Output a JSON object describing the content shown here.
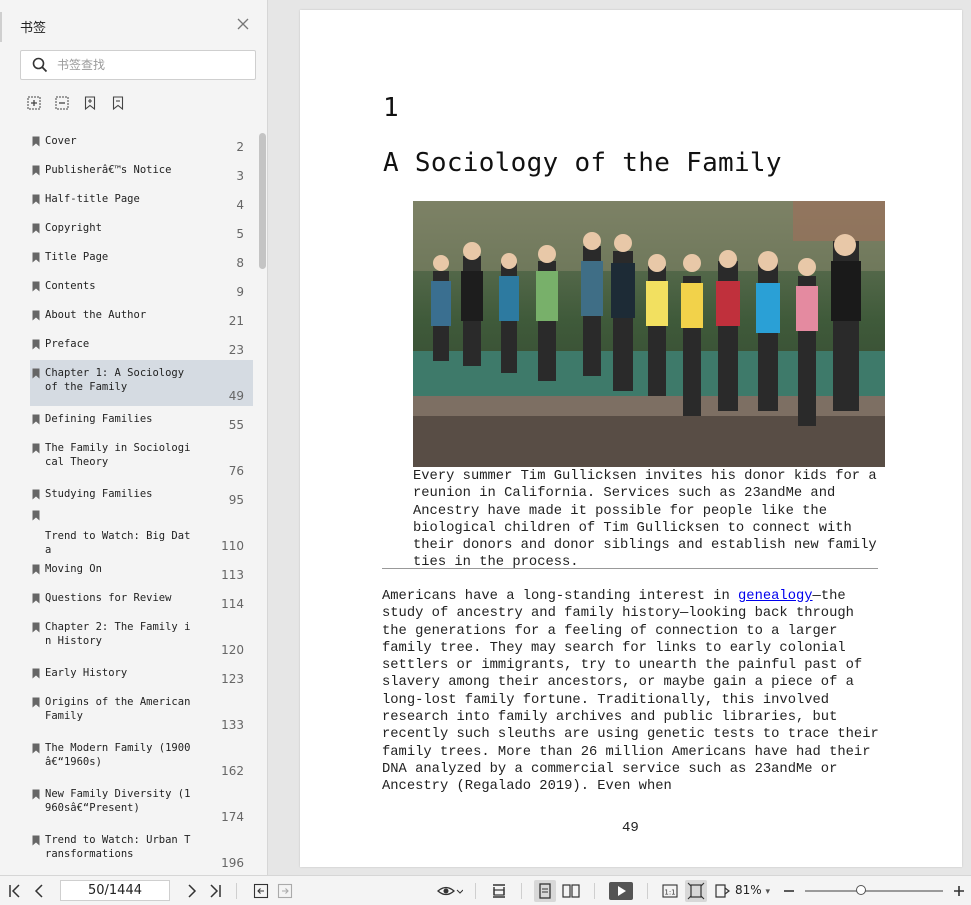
{
  "sidebar": {
    "title": "书签",
    "search_placeholder": "书签查找",
    "bookmarks": [
      {
        "label": "Cover",
        "page": "2"
      },
      {
        "label": "Publisherâ€™s Notice",
        "page": "3"
      },
      {
        "label": "Half-title Page",
        "page": "4"
      },
      {
        "label": "Copyright",
        "page": "5"
      },
      {
        "label": "Title Page",
        "page": "8"
      },
      {
        "label": "Contents",
        "page": "9"
      },
      {
        "label": "About the Author",
        "page": "21"
      },
      {
        "label": "Preface",
        "page": "23"
      },
      {
        "label": "Chapter 1: A Sociology of the Family",
        "page": "49",
        "active": true
      },
      {
        "label": "Defining Families",
        "page": "55"
      },
      {
        "label": "The Family in Sociological Theory",
        "page": "76"
      },
      {
        "label": "Studying Families",
        "page": "95"
      },
      {
        "label": "Trend to Watch: Big Data",
        "page": "110"
      },
      {
        "label": "Moving On",
        "page": "113"
      },
      {
        "label": "Questions for Review",
        "page": "114"
      },
      {
        "label": "Chapter 2: The Family in History",
        "page": "120"
      },
      {
        "label": "Early History",
        "page": "123"
      },
      {
        "label": "Origins of the American Family",
        "page": "133"
      },
      {
        "label": "The Modern Family (1900â€“1960s)",
        "page": "162"
      },
      {
        "label": "New Family Diversity (1960sâ€“Present)",
        "page": "174"
      },
      {
        "label": "Trend to Watch: Urban Transformations",
        "page": "196"
      }
    ]
  },
  "document": {
    "chapter_number": "1",
    "chapter_title": "A Sociology of the Family",
    "caption": "Every summer Tim Gullicksen invites his donor kids for a reunion in California. Services such as 23andMe and Ancestry have made it possible for people like the biological children of Tim Gullicksen to connect with their donors and donor siblings and establish new family ties in the process.",
    "body_before_link": "Americans have a long-standing interest in ",
    "body_link": "genealogy",
    "body_after_link": "—the study of ancestry and family history—looking back through the generations for a feeling of connection to a larger family tree. They may search for links to early colonial settlers or immigrants, try to unearth the painful past of slavery among their ancestors, or maybe gain a piece of a long-lost family fortune. Traditionally, this involved research into family archives and public libraries, but recently such sleuths are using genetic tests to trace their family trees. More than 26 million Americans have had their DNA analyzed by a commercial service such as 23andMe or Ancestry (Regalado 2019). Even when",
    "page_number": "49"
  },
  "toolbar": {
    "page_indicator": "50/1444",
    "zoom": "81%"
  },
  "colors": {
    "active_bookmark": "#d5dbe2",
    "link": "#0000ee",
    "sidebar_bg": "#f4f4f4"
  }
}
